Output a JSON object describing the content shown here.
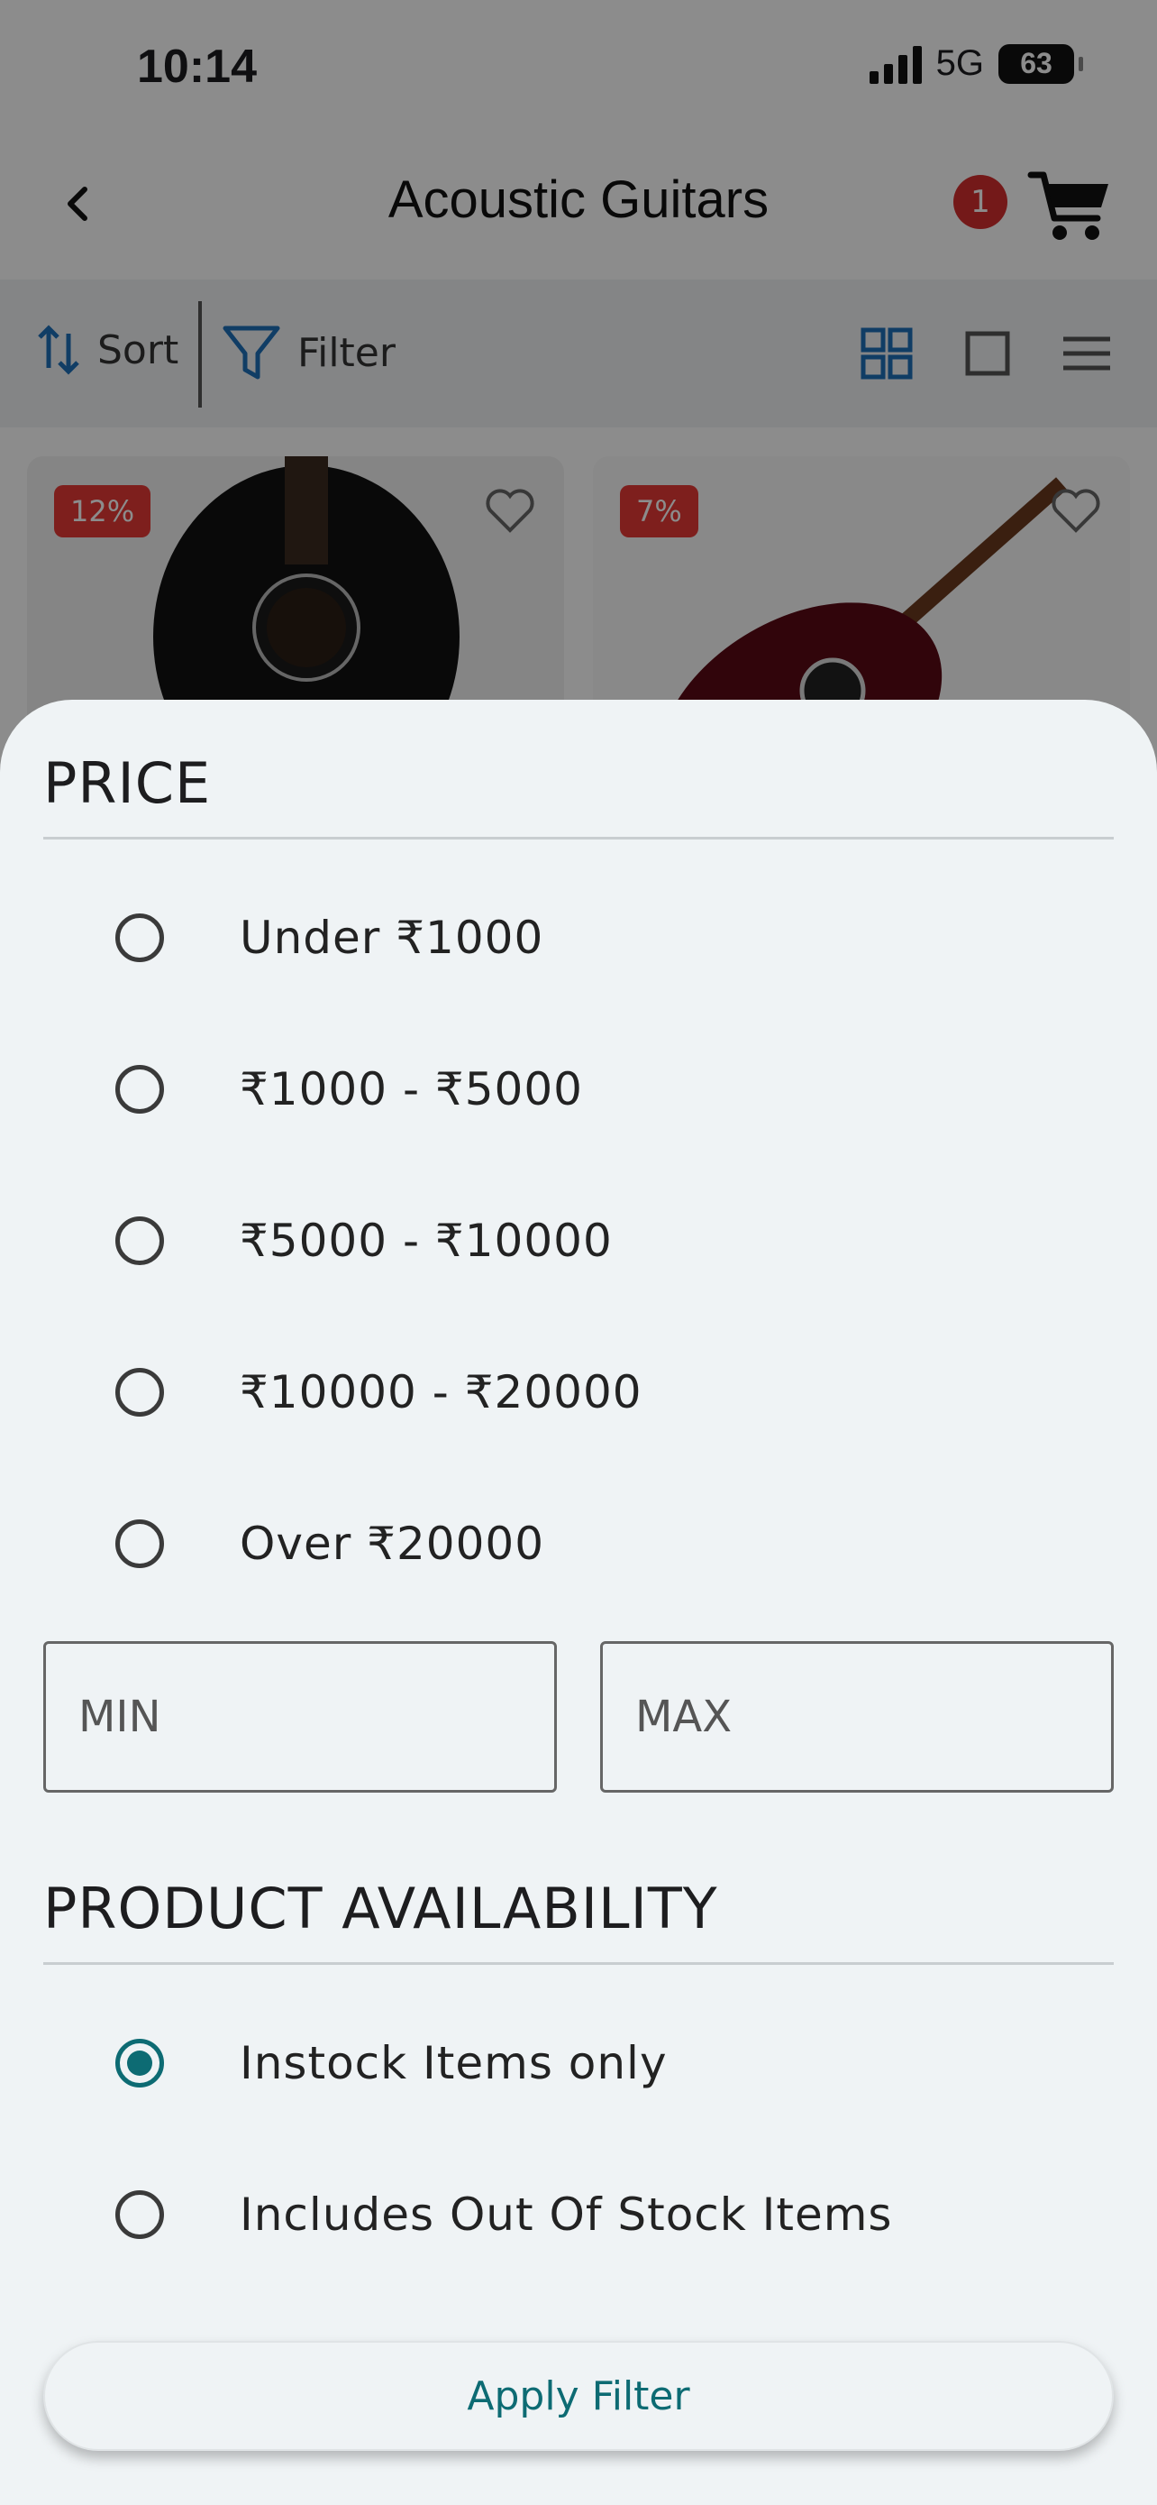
{
  "status_bar": {
    "time": "10:14",
    "network": "5G",
    "battery": "63"
  },
  "header": {
    "title": "Acoustic Guitars",
    "cart_count": "1"
  },
  "toolbar": {
    "sort_label": "Sort",
    "filter_label": "Filter"
  },
  "products": [
    {
      "discount": "12%"
    },
    {
      "discount": "7%"
    }
  ],
  "filter_sheet": {
    "price": {
      "title": "PRICE",
      "options": [
        "Under ₹1000",
        "₹1000 - ₹5000",
        "₹5000 - ₹10000",
        "₹10000 - ₹20000",
        "Over ₹20000"
      ],
      "min_placeholder": "MIN",
      "max_placeholder": "MAX"
    },
    "availability": {
      "title": "PRODUCT AVAILABILITY",
      "options": [
        "Instock Items only",
        "Includes Out Of Stock Items"
      ],
      "selected": "Instock Items only"
    },
    "apply_label": "Apply Filter"
  },
  "colors": {
    "accent": "#0d6b73",
    "badge": "#d32f2f",
    "discount": "#e53935",
    "sheet_bg": "#eff3f5"
  }
}
